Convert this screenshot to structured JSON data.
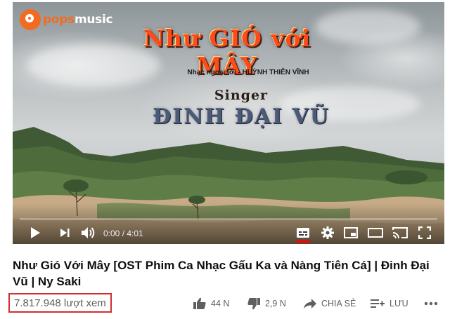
{
  "player": {
    "logo": {
      "brand_a": "pops",
      "brand_b": "music"
    },
    "overlay": {
      "song_title": "Như GIÓ với MÂY",
      "credit": "Nhạc ngoại lời - HUỲNH THIÊN VĨNH",
      "singer_label": "Singer",
      "singer_name": "ĐINH ĐẠI VŨ"
    },
    "time": "0:00 / 4:01",
    "progress_fraction": 0.0,
    "controls": [
      "play-icon",
      "next-icon",
      "volume-icon",
      "subtitles-icon",
      "settings-icon",
      "miniplayer-icon",
      "theater-icon",
      "cast-icon",
      "fullscreen-icon"
    ],
    "colors": {
      "progress": "#ff0000",
      "logo": "#f26b21"
    }
  },
  "video": {
    "title": "Như Gió Với Mây [OST Phim Ca Nhạc Gấu Ka và Nàng Tiên Cá] | Đinh Đại Vũ | Ny Saki",
    "views": "7.817.948 lượt xem"
  },
  "actions": {
    "like": {
      "icon": "thumbs-up-icon",
      "label": "44 N"
    },
    "dislike": {
      "icon": "thumbs-down-icon",
      "label": "2,9 N"
    },
    "share": {
      "icon": "share-icon",
      "label": "CHIA SẺ"
    },
    "save": {
      "icon": "add-to-playlist-icon",
      "label": "LƯU"
    },
    "more": {
      "icon": "more-horizontal-icon"
    }
  }
}
